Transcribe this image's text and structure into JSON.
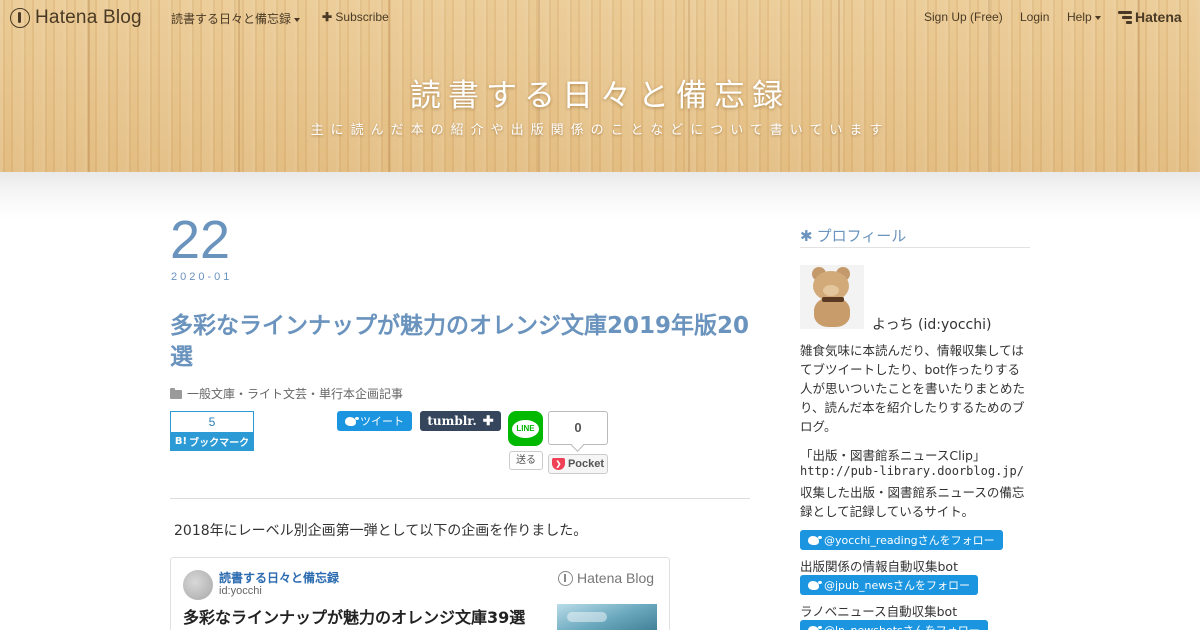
{
  "topbar": {
    "brand": "Hatena Blog",
    "blog_menu": "読書する日々と備忘録",
    "subscribe": "Subscribe",
    "signup": "Sign Up (Free)",
    "login": "Login",
    "help": "Help",
    "hatena": "Hatena"
  },
  "header": {
    "title": "読書する日々と備忘録",
    "description": "主に読んだ本の紹介や出版関係のことなどについて書いています"
  },
  "entry": {
    "day": "22",
    "year_month": "2020-01",
    "title": "多彩なラインナップが魅力のオレンジ文庫2019年版20選",
    "category": "一般文庫・ライト文芸・単行本企画記事",
    "intro": "2018年にレーベル別企画第一弾として以下の企画を作りました。"
  },
  "share": {
    "hatebu_count": "5",
    "hatebu_label": "ブックマーク",
    "tweet": "ツイート",
    "tumblr": "tumblr.",
    "tumblr_plus": "✚",
    "line_text": "LINE",
    "line_send": "送る",
    "pocket_count": "0",
    "pocket": "Pocket"
  },
  "card": {
    "blog": "読書する日々と備忘録",
    "id": "id:yocchi",
    "brand": "Hatena Blog",
    "title": "多彩なラインナップが魅力のオレンジ文庫39選"
  },
  "sidebar": {
    "heading": "プロフィール",
    "name": "よっち (id:yocchi)",
    "bio": "雑食気味に本読んだり、情報収集してはてブツイートしたり、bot作ったりする人が思いついたことを書いたりまとめたり、読んだ本を紹介したりするためのブログ。",
    "clip_title": "「出版・図書館系ニュースClip」",
    "clip_url": "http://pub-library.doorblog.jp/",
    "clip_desc": "収集した出版・図書館系ニュースの備忘録として記録しているサイト。",
    "follow1": "@yocchi_readingさんをフォロー",
    "bot1_label": "出版関係の情報自動収集bot",
    "follow2": "@jpub_newsさんをフォロー",
    "bot2_label": "ラノベニュース自動収集bot",
    "follow3": "@ln_newsbotsさんをフォロー"
  }
}
